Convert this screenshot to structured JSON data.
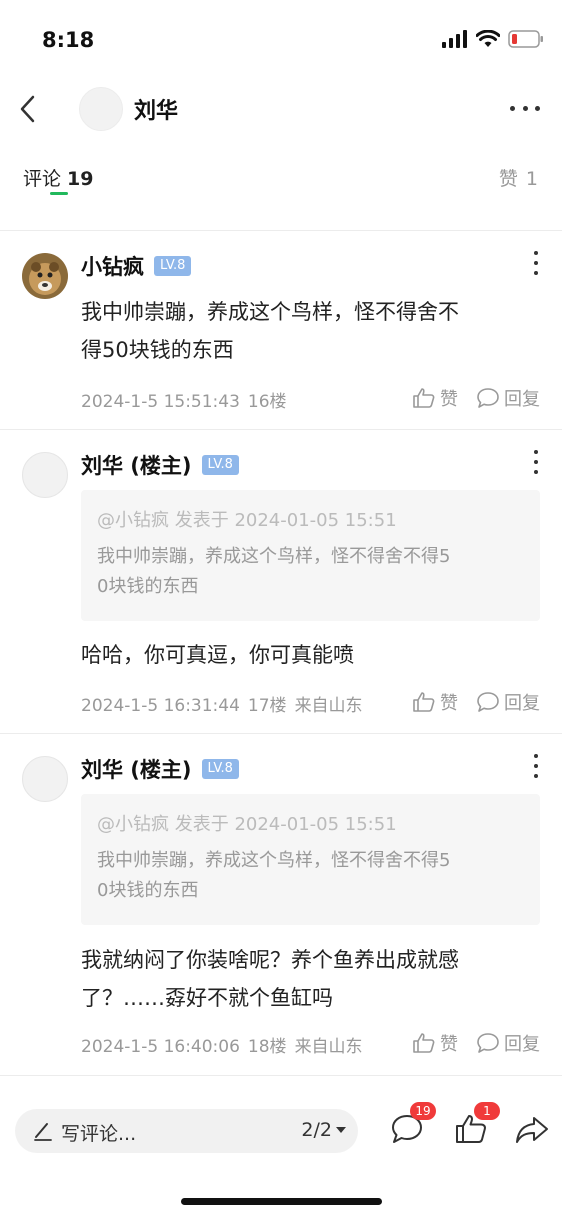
{
  "status": {
    "time": "8:18"
  },
  "nav": {
    "title": "刘华"
  },
  "tabs": {
    "comments_label": "评论",
    "comments_count": "19",
    "likes_label": "赞",
    "likes_count": "1"
  },
  "comments": [
    {
      "name": "小钻疯",
      "level": "LV.8",
      "text_lines": [
        "我中帅崇蹦，养成这个鸟样，怪不得舍不",
        "得50块钱的东西"
      ],
      "time": "2024-1-5 15:51:43",
      "floor": "16楼",
      "location": "",
      "like_label": "赞",
      "reply_label": "回复"
    },
    {
      "name": "刘华 (楼主)",
      "level": "LV.8",
      "quote_head": "@小钻疯 发表于 2024-01-05 15:51",
      "quote_lines": [
        "我中帅崇蹦，养成这个鸟样，怪不得舍不得5",
        "0块钱的东西"
      ],
      "text_lines": [
        "哈哈，你可真逗，你可真能喷"
      ],
      "time": "2024-1-5 16:31:44",
      "floor": "17楼",
      "location": "来自山东",
      "like_label": "赞",
      "reply_label": "回复"
    },
    {
      "name": "刘华 (楼主)",
      "level": "LV.8",
      "quote_head": "@小钻疯 发表于 2024-01-05 15:51",
      "quote_lines": [
        "我中帅崇蹦，养成这个鸟样，怪不得舍不得5",
        "0块钱的东西"
      ],
      "text_lines": [
        "我就纳闷了你装啥呢？养个鱼养出成就感",
        "了？……孬好不就个鱼缸吗"
      ],
      "time": "2024-1-5 16:40:06",
      "floor": "18楼",
      "location": "来自山东",
      "like_label": "赞",
      "reply_label": "回复"
    }
  ],
  "bottom": {
    "write_placeholder": "写评论...",
    "page_indicator": "2/2",
    "comments_badge": "19",
    "likes_badge": "1"
  },
  "colors": {
    "accent_green": "#21b85c",
    "level_badge": "#8fb7ea",
    "badge_red": "#f03a3a"
  }
}
